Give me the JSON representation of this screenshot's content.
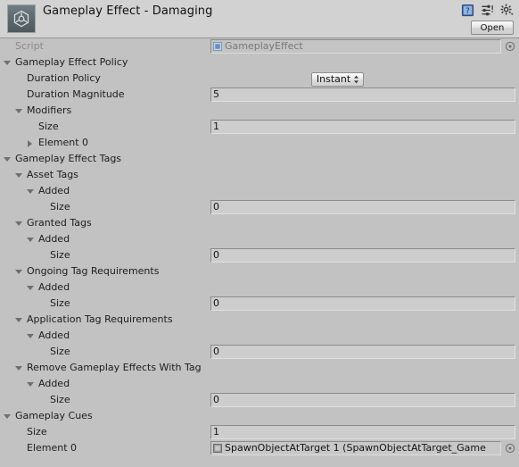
{
  "header": {
    "title": "Gameplay Effect - Damaging",
    "asset_icon": "unity-asset-icon",
    "help_icon": "help-book-icon",
    "preset_icon": "preset-icon",
    "settings_icon": "gear-dropdown-icon",
    "open_label": "Open"
  },
  "rows": [
    {
      "label": "Script",
      "indent": 0,
      "fold": "none",
      "disabled": true,
      "field": "object",
      "value": "GameplayEffect",
      "picker": true
    },
    {
      "label": "Gameplay Effect Policy",
      "indent": 0,
      "fold": "open",
      "field": "none"
    },
    {
      "label": "Duration Policy",
      "indent": 1,
      "fold": "none",
      "field": "popup",
      "value": "Instant"
    },
    {
      "label": "Duration Magnitude",
      "indent": 1,
      "fold": "none",
      "field": "text",
      "value": "5"
    },
    {
      "label": "Modifiers",
      "indent": 1,
      "fold": "open",
      "field": "none"
    },
    {
      "label": "Size",
      "indent": 2,
      "fold": "none",
      "field": "text",
      "value": "1"
    },
    {
      "label": "Element 0",
      "indent": 2,
      "fold": "closed",
      "field": "none"
    },
    {
      "label": "Gameplay Effect Tags",
      "indent": 0,
      "fold": "open",
      "field": "none"
    },
    {
      "label": "Asset Tags",
      "indent": 1,
      "fold": "open",
      "field": "none"
    },
    {
      "label": "Added",
      "indent": 2,
      "fold": "open",
      "field": "none"
    },
    {
      "label": "Size",
      "indent": 3,
      "fold": "none",
      "field": "text",
      "value": "0"
    },
    {
      "label": "Granted Tags",
      "indent": 1,
      "fold": "open",
      "field": "none"
    },
    {
      "label": "Added",
      "indent": 2,
      "fold": "open",
      "field": "none"
    },
    {
      "label": "Size",
      "indent": 3,
      "fold": "none",
      "field": "text",
      "value": "0"
    },
    {
      "label": "Ongoing Tag Requirements",
      "indent": 1,
      "fold": "open",
      "field": "none"
    },
    {
      "label": "Added",
      "indent": 2,
      "fold": "open",
      "field": "none"
    },
    {
      "label": "Size",
      "indent": 3,
      "fold": "none",
      "field": "text",
      "value": "0"
    },
    {
      "label": "Application Tag Requirements",
      "indent": 1,
      "fold": "open",
      "field": "none"
    },
    {
      "label": "Added",
      "indent": 2,
      "fold": "open",
      "field": "none"
    },
    {
      "label": "Size",
      "indent": 3,
      "fold": "none",
      "field": "text",
      "value": "0"
    },
    {
      "label": "Remove Gameplay Effects With Tag",
      "indent": 1,
      "fold": "open",
      "field": "none"
    },
    {
      "label": "Added",
      "indent": 2,
      "fold": "open",
      "field": "none"
    },
    {
      "label": "Size",
      "indent": 3,
      "fold": "none",
      "field": "text",
      "value": "0"
    },
    {
      "label": "Gameplay Cues",
      "indent": 0,
      "fold": "open",
      "field": "none"
    },
    {
      "label": "Size",
      "indent": 1,
      "fold": "none",
      "field": "text",
      "value": "1"
    },
    {
      "label": "Element 0",
      "indent": 1,
      "fold": "none",
      "field": "object",
      "value": "SpawnObjectAtTarget 1 (SpawnObjectAtTarget_Game",
      "picker": true
    }
  ],
  "colors": {
    "window_bg": "#c2c2c2",
    "header_bg": "#d2d2d2",
    "field_bg": "#cdcdcd",
    "text": "#1c1c1c",
    "disabled_text": "#8a8a8a"
  }
}
